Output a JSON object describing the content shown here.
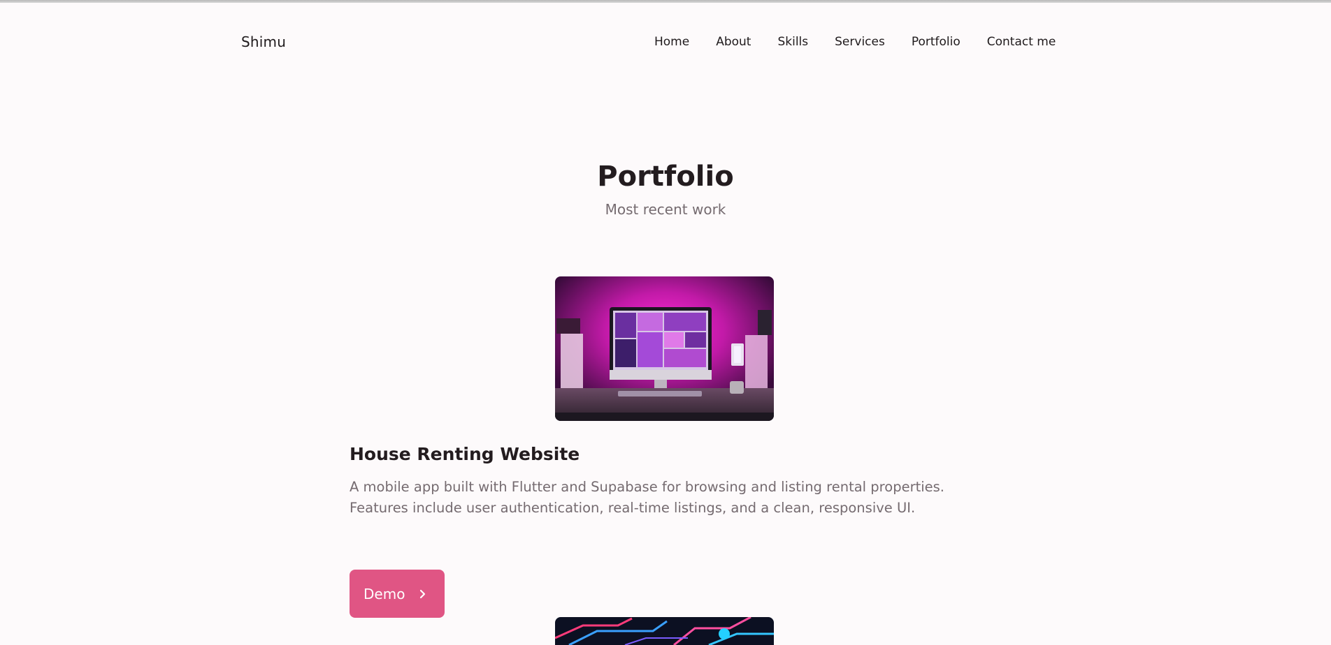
{
  "header": {
    "logo": "Shimu",
    "nav": [
      {
        "label": "Home"
      },
      {
        "label": "About"
      },
      {
        "label": "Skills"
      },
      {
        "label": "Services"
      },
      {
        "label": "Portfolio"
      },
      {
        "label": "Contact me"
      }
    ]
  },
  "portfolio": {
    "title": "Portfolio",
    "subtitle": "Most recent work",
    "projects": [
      {
        "title": "House Renting Website",
        "description_line1": "A mobile app built with Flutter and Supabase for browsing and listing rental properties.",
        "description_line2": "Features include user authentication, real-time listings, and a clean, responsive UI.",
        "button_label": "Demo",
        "button_icon": "chevron-right-icon"
      }
    ]
  },
  "colors": {
    "accent": "#e05584",
    "heading": "#231c1f",
    "muted": "#756b70",
    "background": "#fdfafb"
  }
}
